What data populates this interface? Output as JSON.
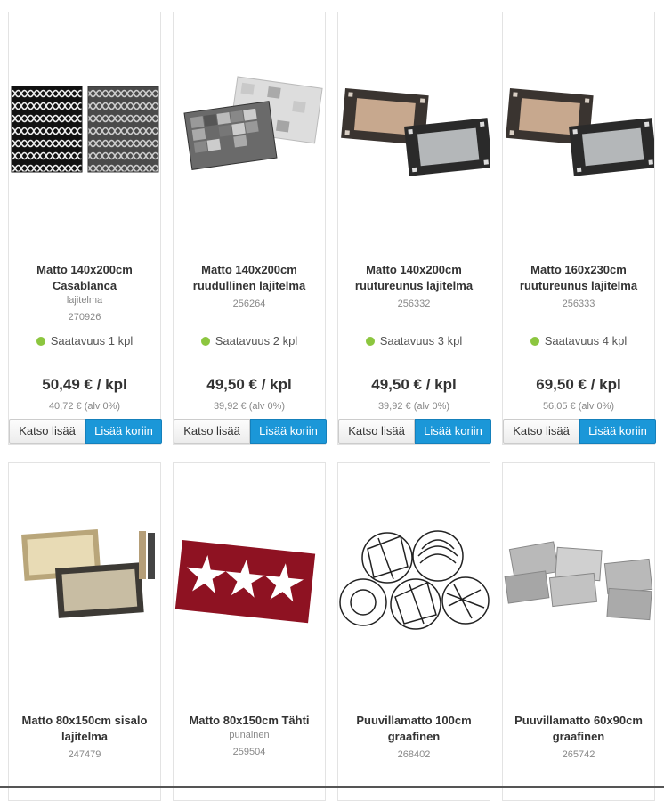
{
  "products": [
    {
      "title": "Matto 140x200cm Casablanca",
      "variant": "lajitelma",
      "sku": "270926",
      "availability": "Saatavuus 1 kpl",
      "price": "50,49 € / kpl",
      "net_price": "40,72 € (alv 0%)",
      "more_label": "Katso lisää",
      "cart_label": "Lisää koriin"
    },
    {
      "title": "Matto 140x200cm ruudullinen lajitelma",
      "sku": "256264",
      "availability": "Saatavuus 2 kpl",
      "price": "49,50 € / kpl",
      "net_price": "39,92 € (alv 0%)",
      "more_label": "Katso lisää",
      "cart_label": "Lisää koriin"
    },
    {
      "title": "Matto 140x200cm ruutureunus lajitelma",
      "sku": "256332",
      "availability": "Saatavuus 3 kpl",
      "price": "49,50 € / kpl",
      "net_price": "39,92 € (alv 0%)",
      "more_label": "Katso lisää",
      "cart_label": "Lisää koriin"
    },
    {
      "title": "Matto 160x230cm ruutureunus lajitelma",
      "sku": "256333",
      "availability": "Saatavuus 4 kpl",
      "price": "69,50 € / kpl",
      "net_price": "56,05 € (alv 0%)",
      "more_label": "Katso lisää",
      "cart_label": "Lisää koriin"
    },
    {
      "title": "Matto 80x150cm sisalo lajitelma",
      "sku": "247479"
    },
    {
      "title": "Matto 80x150cm Tähti",
      "variant": "punainen",
      "sku": "259504"
    },
    {
      "title": "Puuvillamatto 100cm graafinen",
      "sku": "268402"
    },
    {
      "title": "Puuvillamatto 60x90cm graafinen",
      "sku": "265742"
    }
  ],
  "colors": {
    "available": "#8cc63f",
    "cart_button": "#1b97d8"
  }
}
